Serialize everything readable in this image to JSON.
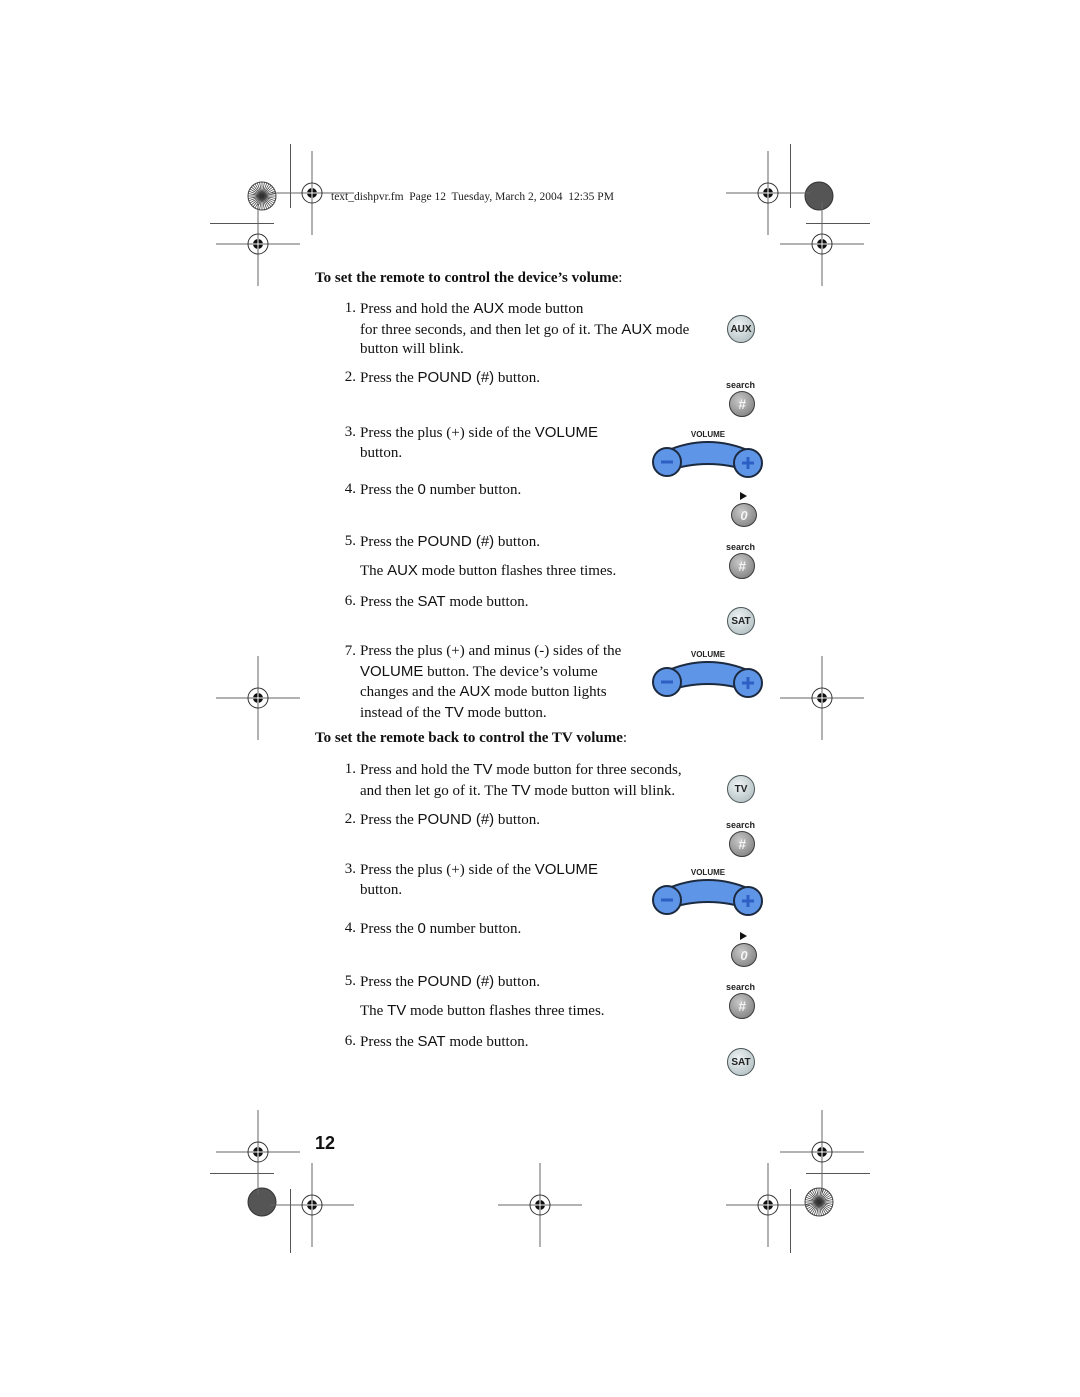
{
  "header": {
    "file_info": "text_dishpvr.fm  Page 12  Tuesday, March 2, 2004  12:35 PM"
  },
  "sections": [
    {
      "title": "To set the remote to control the device’s volume",
      "title_suffix": ":",
      "steps": [
        {
          "num": "1.",
          "parts": [
            "Press and hold the ",
            "AUX",
            " mode button"
          ],
          "line2_parts": [
            "for three seconds, and then let go of it. The ",
            "AUX",
            " mode"
          ],
          "line3": "button will blink.",
          "icon": "aux-mode-button",
          "icon_label": "AUX"
        },
        {
          "num": "2.",
          "parts": [
            "Press the ",
            "POUND (#)",
            " button."
          ],
          "icon": "pound-button",
          "icon_label": "#",
          "icon_caption": "search"
        },
        {
          "num": "3.",
          "parts": [
            "Press the plus (+) side of the ",
            "VOLUME"
          ],
          "line2": "button.",
          "icon": "volume-rocker",
          "icon_caption": "VOLUME"
        },
        {
          "num": "4.",
          "parts": [
            "Press the ",
            "0",
            " number button."
          ],
          "icon": "zero-button",
          "icon_label": "0"
        },
        {
          "num": "5.",
          "parts": [
            "Press the ",
            "POUND (#)",
            " button."
          ],
          "note_parts": [
            "The ",
            "AUX",
            " mode button flashes three times."
          ],
          "icon": "pound-button",
          "icon_label": "#",
          "icon_caption": "search"
        },
        {
          "num": "6.",
          "parts": [
            "Press the ",
            "SAT",
            " mode button."
          ],
          "icon": "sat-mode-button",
          "icon_label": "SAT"
        },
        {
          "num": "7.",
          "parts": [
            "Press the plus (+) and minus (-) sides of the"
          ],
          "line2_parts": [
            "VOLUME",
            " button. The device’s volume"
          ],
          "line3_parts": [
            "changes and the ",
            "AUX",
            " mode button lights"
          ],
          "line4_parts": [
            "instead of the ",
            "TV",
            " mode button."
          ],
          "icon": "volume-rocker",
          "icon_caption": "VOLUME"
        }
      ]
    },
    {
      "title": "To set the remote back to control the TV volume",
      "title_suffix": ":",
      "steps": [
        {
          "num": "1.",
          "parts": [
            "Press and hold the ",
            "TV",
            " mode button for three seconds,"
          ],
          "line2_parts": [
            "and then let go of it. The ",
            "TV",
            " mode button will blink."
          ],
          "icon": "tv-mode-button",
          "icon_label": "TV"
        },
        {
          "num": "2.",
          "parts": [
            "Press the ",
            "POUND (#)",
            " button."
          ],
          "icon": "pound-button",
          "icon_label": "#",
          "icon_caption": "search"
        },
        {
          "num": "3.",
          "parts": [
            "Press the plus (+) side of the ",
            "VOLUME"
          ],
          "line2": "button.",
          "icon": "volume-rocker",
          "icon_caption": "VOLUME"
        },
        {
          "num": "4.",
          "parts": [
            "Press the ",
            "0",
            " number button."
          ],
          "icon": "zero-button",
          "icon_label": "0"
        },
        {
          "num": "5.",
          "parts": [
            "Press the ",
            "POUND (#)",
            " button."
          ],
          "note_parts": [
            "The ",
            "TV",
            " mode button flashes three times."
          ],
          "icon": "pound-button",
          "icon_label": "#",
          "icon_caption": "search"
        },
        {
          "num": "6.",
          "parts": [
            "Press the ",
            "SAT",
            " mode button."
          ],
          "icon": "sat-mode-button",
          "icon_label": "SAT"
        }
      ]
    }
  ],
  "footer": {
    "page_number": "12"
  },
  "colors": {
    "volume_blue": "#5f95e6",
    "volume_blue_dark": "#2d5fc4",
    "mode_button": "#c5d0d2",
    "pound_button": "#8d8d8d"
  }
}
